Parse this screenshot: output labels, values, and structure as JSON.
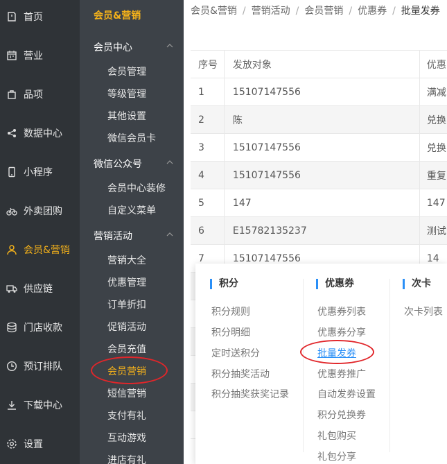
{
  "nav1": [
    {
      "label": "首页",
      "icon": "home-icon"
    },
    {
      "label": "营业",
      "icon": "calendar-icon"
    },
    {
      "label": "品项",
      "icon": "bag-icon"
    },
    {
      "label": "数据中心",
      "icon": "share-icon"
    },
    {
      "label": "小程序",
      "icon": "phone-icon"
    },
    {
      "label": "外卖团购",
      "icon": "bike-icon"
    },
    {
      "label": "会员&营销",
      "icon": "user-icon",
      "active": true
    },
    {
      "label": "供应链",
      "icon": "truck-icon"
    },
    {
      "label": "门店收款",
      "icon": "coin-icon"
    },
    {
      "label": "预订排队",
      "icon": "clock-icon"
    },
    {
      "label": "下载中心",
      "icon": "download-icon"
    },
    {
      "label": "设置",
      "icon": "gear-icon"
    }
  ],
  "nav2": {
    "header": "会员&营销",
    "groups": [
      {
        "title": "会员中心",
        "items": [
          "会员管理",
          "等级管理",
          "其他设置",
          "微信会员卡"
        ]
      },
      {
        "title": "微信公众号",
        "items": [
          "会员中心装修",
          "自定义菜单"
        ]
      },
      {
        "title": "营销活动",
        "items": [
          "营销大全",
          "优惠管理",
          "订单折扣",
          "促销活动",
          "会员充值",
          "会员营销",
          "短信营销",
          "支付有礼",
          "互动游戏",
          "进店有礼"
        ]
      }
    ]
  },
  "breadcrumb": [
    "会员&营销",
    "营销活动",
    "会员营销",
    "优惠券",
    "批量发券"
  ],
  "table": {
    "headers": [
      "序号",
      "发放对象",
      "优惠"
    ],
    "rows": [
      [
        "1",
        "15107147556",
        "满减"
      ],
      [
        "2",
        "陈",
        "兑换"
      ],
      [
        "3",
        "15107147556",
        "兑换"
      ],
      [
        "4",
        "15107147556",
        "重复"
      ],
      [
        "5",
        "147",
        "147"
      ],
      [
        "6",
        "E15782135237",
        "测试"
      ],
      [
        "7",
        "15107147556",
        "14"
      ]
    ]
  },
  "panel": {
    "columns": [
      {
        "title": "积分",
        "links": [
          "积分规则",
          "积分明细",
          "定时送积分",
          "积分抽奖活动",
          "积分抽奖获奖记录"
        ]
      },
      {
        "title": "优惠券",
        "links": [
          "优惠券列表",
          "优惠券分享",
          "批量发券",
          "优惠券推广",
          "自动发券设置",
          "积分兑换券",
          "礼包购买",
          "礼包分享"
        ],
        "current": "批量发券"
      },
      {
        "title": "次卡",
        "links": [
          "次卡列表"
        ]
      }
    ]
  },
  "colors": {
    "accent": "#f5b21a",
    "link": "#2a8ff7",
    "highlight": "#e1262a"
  }
}
